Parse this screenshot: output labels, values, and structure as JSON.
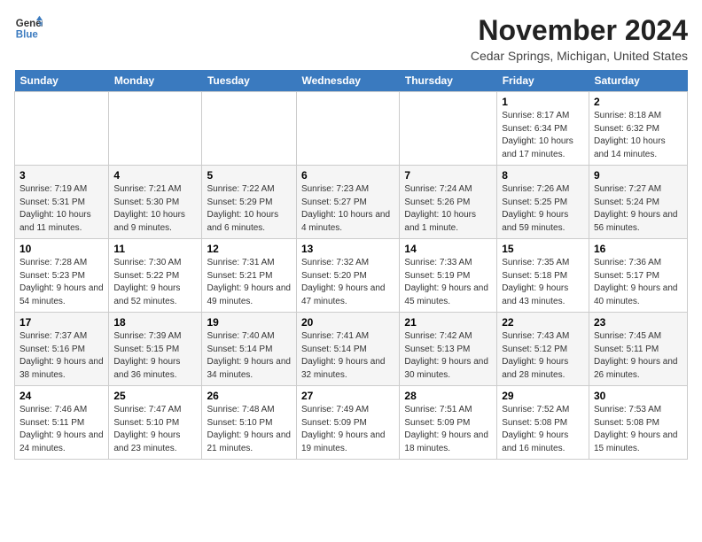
{
  "header": {
    "logo_line1": "General",
    "logo_line2": "Blue",
    "month": "November 2024",
    "location": "Cedar Springs, Michigan, United States"
  },
  "days_of_week": [
    "Sunday",
    "Monday",
    "Tuesday",
    "Wednesday",
    "Thursday",
    "Friday",
    "Saturday"
  ],
  "weeks": [
    [
      {
        "day": "",
        "info": ""
      },
      {
        "day": "",
        "info": ""
      },
      {
        "day": "",
        "info": ""
      },
      {
        "day": "",
        "info": ""
      },
      {
        "day": "",
        "info": ""
      },
      {
        "day": "1",
        "info": "Sunrise: 8:17 AM\nSunset: 6:34 PM\nDaylight: 10 hours and 17 minutes."
      },
      {
        "day": "2",
        "info": "Sunrise: 8:18 AM\nSunset: 6:32 PM\nDaylight: 10 hours and 14 minutes."
      }
    ],
    [
      {
        "day": "3",
        "info": "Sunrise: 7:19 AM\nSunset: 5:31 PM\nDaylight: 10 hours and 11 minutes."
      },
      {
        "day": "4",
        "info": "Sunrise: 7:21 AM\nSunset: 5:30 PM\nDaylight: 10 hours and 9 minutes."
      },
      {
        "day": "5",
        "info": "Sunrise: 7:22 AM\nSunset: 5:29 PM\nDaylight: 10 hours and 6 minutes."
      },
      {
        "day": "6",
        "info": "Sunrise: 7:23 AM\nSunset: 5:27 PM\nDaylight: 10 hours and 4 minutes."
      },
      {
        "day": "7",
        "info": "Sunrise: 7:24 AM\nSunset: 5:26 PM\nDaylight: 10 hours and 1 minute."
      },
      {
        "day": "8",
        "info": "Sunrise: 7:26 AM\nSunset: 5:25 PM\nDaylight: 9 hours and 59 minutes."
      },
      {
        "day": "9",
        "info": "Sunrise: 7:27 AM\nSunset: 5:24 PM\nDaylight: 9 hours and 56 minutes."
      }
    ],
    [
      {
        "day": "10",
        "info": "Sunrise: 7:28 AM\nSunset: 5:23 PM\nDaylight: 9 hours and 54 minutes."
      },
      {
        "day": "11",
        "info": "Sunrise: 7:30 AM\nSunset: 5:22 PM\nDaylight: 9 hours and 52 minutes."
      },
      {
        "day": "12",
        "info": "Sunrise: 7:31 AM\nSunset: 5:21 PM\nDaylight: 9 hours and 49 minutes."
      },
      {
        "day": "13",
        "info": "Sunrise: 7:32 AM\nSunset: 5:20 PM\nDaylight: 9 hours and 47 minutes."
      },
      {
        "day": "14",
        "info": "Sunrise: 7:33 AM\nSunset: 5:19 PM\nDaylight: 9 hours and 45 minutes."
      },
      {
        "day": "15",
        "info": "Sunrise: 7:35 AM\nSunset: 5:18 PM\nDaylight: 9 hours and 43 minutes."
      },
      {
        "day": "16",
        "info": "Sunrise: 7:36 AM\nSunset: 5:17 PM\nDaylight: 9 hours and 40 minutes."
      }
    ],
    [
      {
        "day": "17",
        "info": "Sunrise: 7:37 AM\nSunset: 5:16 PM\nDaylight: 9 hours and 38 minutes."
      },
      {
        "day": "18",
        "info": "Sunrise: 7:39 AM\nSunset: 5:15 PM\nDaylight: 9 hours and 36 minutes."
      },
      {
        "day": "19",
        "info": "Sunrise: 7:40 AM\nSunset: 5:14 PM\nDaylight: 9 hours and 34 minutes."
      },
      {
        "day": "20",
        "info": "Sunrise: 7:41 AM\nSunset: 5:14 PM\nDaylight: 9 hours and 32 minutes."
      },
      {
        "day": "21",
        "info": "Sunrise: 7:42 AM\nSunset: 5:13 PM\nDaylight: 9 hours and 30 minutes."
      },
      {
        "day": "22",
        "info": "Sunrise: 7:43 AM\nSunset: 5:12 PM\nDaylight: 9 hours and 28 minutes."
      },
      {
        "day": "23",
        "info": "Sunrise: 7:45 AM\nSunset: 5:11 PM\nDaylight: 9 hours and 26 minutes."
      }
    ],
    [
      {
        "day": "24",
        "info": "Sunrise: 7:46 AM\nSunset: 5:11 PM\nDaylight: 9 hours and 24 minutes."
      },
      {
        "day": "25",
        "info": "Sunrise: 7:47 AM\nSunset: 5:10 PM\nDaylight: 9 hours and 23 minutes."
      },
      {
        "day": "26",
        "info": "Sunrise: 7:48 AM\nSunset: 5:10 PM\nDaylight: 9 hours and 21 minutes."
      },
      {
        "day": "27",
        "info": "Sunrise: 7:49 AM\nSunset: 5:09 PM\nDaylight: 9 hours and 19 minutes."
      },
      {
        "day": "28",
        "info": "Sunrise: 7:51 AM\nSunset: 5:09 PM\nDaylight: 9 hours and 18 minutes."
      },
      {
        "day": "29",
        "info": "Sunrise: 7:52 AM\nSunset: 5:08 PM\nDaylight: 9 hours and 16 minutes."
      },
      {
        "day": "30",
        "info": "Sunrise: 7:53 AM\nSunset: 5:08 PM\nDaylight: 9 hours and 15 minutes."
      }
    ]
  ]
}
